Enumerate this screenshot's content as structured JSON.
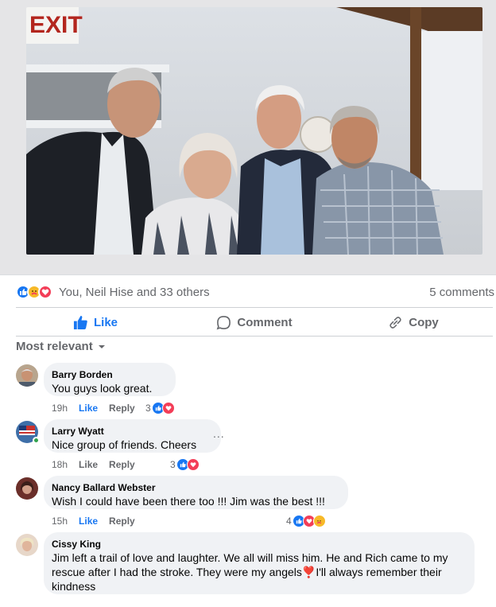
{
  "post": {
    "photo_exit_sign": "EXIT",
    "reactions_text": "You, Neil Hise and 33 others",
    "comments_count": "5 comments"
  },
  "actions": {
    "like": "Like",
    "comment": "Comment",
    "copy": "Copy"
  },
  "sort_label": "Most relevant",
  "comments": [
    {
      "name": "Barry Borden",
      "text": "You guys look great.",
      "time": "19h",
      "like": "Like",
      "reply": "Reply",
      "reaction_count": "3"
    },
    {
      "name": "Larry Wyatt",
      "text": "Nice group of friends. Cheers",
      "time": "18h",
      "like": "Like",
      "reply": "Reply",
      "reaction_count": "3",
      "more": "..."
    },
    {
      "name": "Nancy Ballard Webster",
      "text": "Wish I could have been there too !!! Jim was the best !!!",
      "time": "15h",
      "like": "Like",
      "reply": "Reply",
      "reaction_count": "4"
    },
    {
      "name": "Cissy King",
      "text_line1": "Jim left a trail of love and laughter. We all will miss him. He and Rich came to my",
      "text_line2": "rescue after I had the stroke. They were my angels❣️I'll always remember their",
      "text_line3": "kindness"
    }
  ],
  "colors": {
    "accent": "#1877f2",
    "love": "#f33e58",
    "care": "#f7b928",
    "bubble": "#f0f2f5",
    "meta": "#65676b"
  }
}
